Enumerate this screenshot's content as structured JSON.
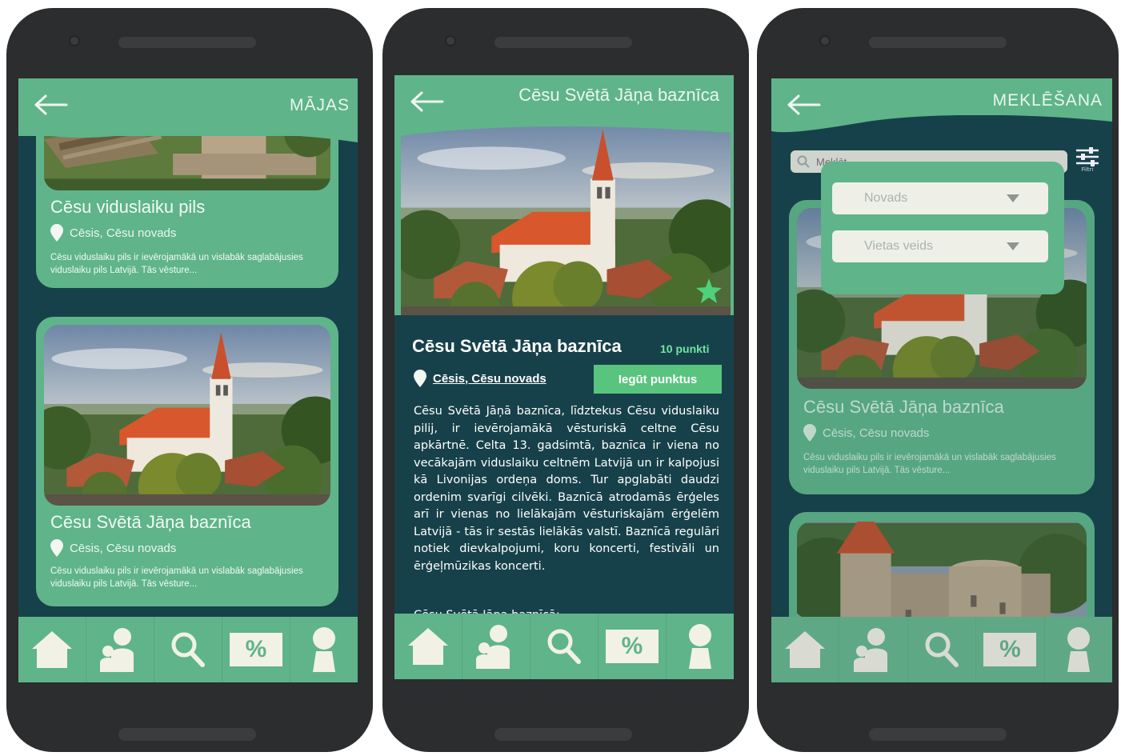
{
  "phones": [
    {
      "header_title": "MĀJAS",
      "cards": [
        {
          "title": "Cēsu viduslaiku pils",
          "location": "Cēsis, Cēsu novads",
          "description": "Cēsu viduslaiku pils ir ievērojamākā un vislabāk saglabājusies viduslaiku pils Latvijā. Tās vēsture..."
        },
        {
          "title": "Cēsu Svētā Jāņa baznīca",
          "location": "Cēsis, Cēsu novads",
          "description": "Cēsu viduslaiku pils ir ievērojamākā un vislabāk saglabājusies viduslaiku pils Latvijā. Tās vēsture..."
        }
      ]
    },
    {
      "header_title": "Cēsu Svētā Jāņa baznīca",
      "detail": {
        "title": "Cēsu Svētā Jāņa baznīca",
        "points": "10 punkti",
        "location": "Cēsis, Cēsu novads",
        "button_label": "Iegūt punktus",
        "body": "Cēsu Svētā Jāņā baznīca, līdztekus Cēsu viduslaiku pilij, ir ievērojamākā vēsturiskā celtne Cēsu apkārtnē. Celta 13. gadsimtā, baznīca ir viena no vecākajām viduslaiku celtnēm Latvijā un ir kalpojusi kā Livonijas ordeņa doms. Tur apglabāti daudzi ordenim svarīgi cilvēki. Baznīcā atrodamās ērģeles arī ir vienas no lielākajām vēsturiskajām ērģelēm Latvijā - tās ir sestās lielākās valstī. Baznīcā regulāri notiek dievkalpojumi, koru koncerti, festivāli un ērģeļmūzikas koncerti.",
        "subheading": "Cēsu Svētā Jāņa baznīcā:"
      }
    },
    {
      "header_title": "MEKLĒŠANA",
      "search": {
        "placeholder": "Meklēt",
        "filter_label": "Filtri"
      },
      "filters": [
        {
          "label": "Novads"
        },
        {
          "label": "Vietas veids"
        }
      ],
      "cards": [
        {
          "title": "Cēsu Svētā Jāņa baznīca",
          "location": "Cēsis, Cēsu novads",
          "description": "Cēsu viduslaiku pils ir ievērojamākā un vislabāk saglabājusies viduslaiku pils Latvijā. Tās vēsture..."
        }
      ]
    }
  ],
  "navigation": [
    "home-icon",
    "people-icon",
    "search-icon",
    "discount-icon",
    "profile-icon"
  ],
  "nav_percent_symbol": "%",
  "colors": {
    "header": "#5fb48a",
    "background": "#17414a",
    "text_light": "#f1fbf4",
    "button": "#59c47e",
    "accent_text": "#6fe6a0"
  }
}
